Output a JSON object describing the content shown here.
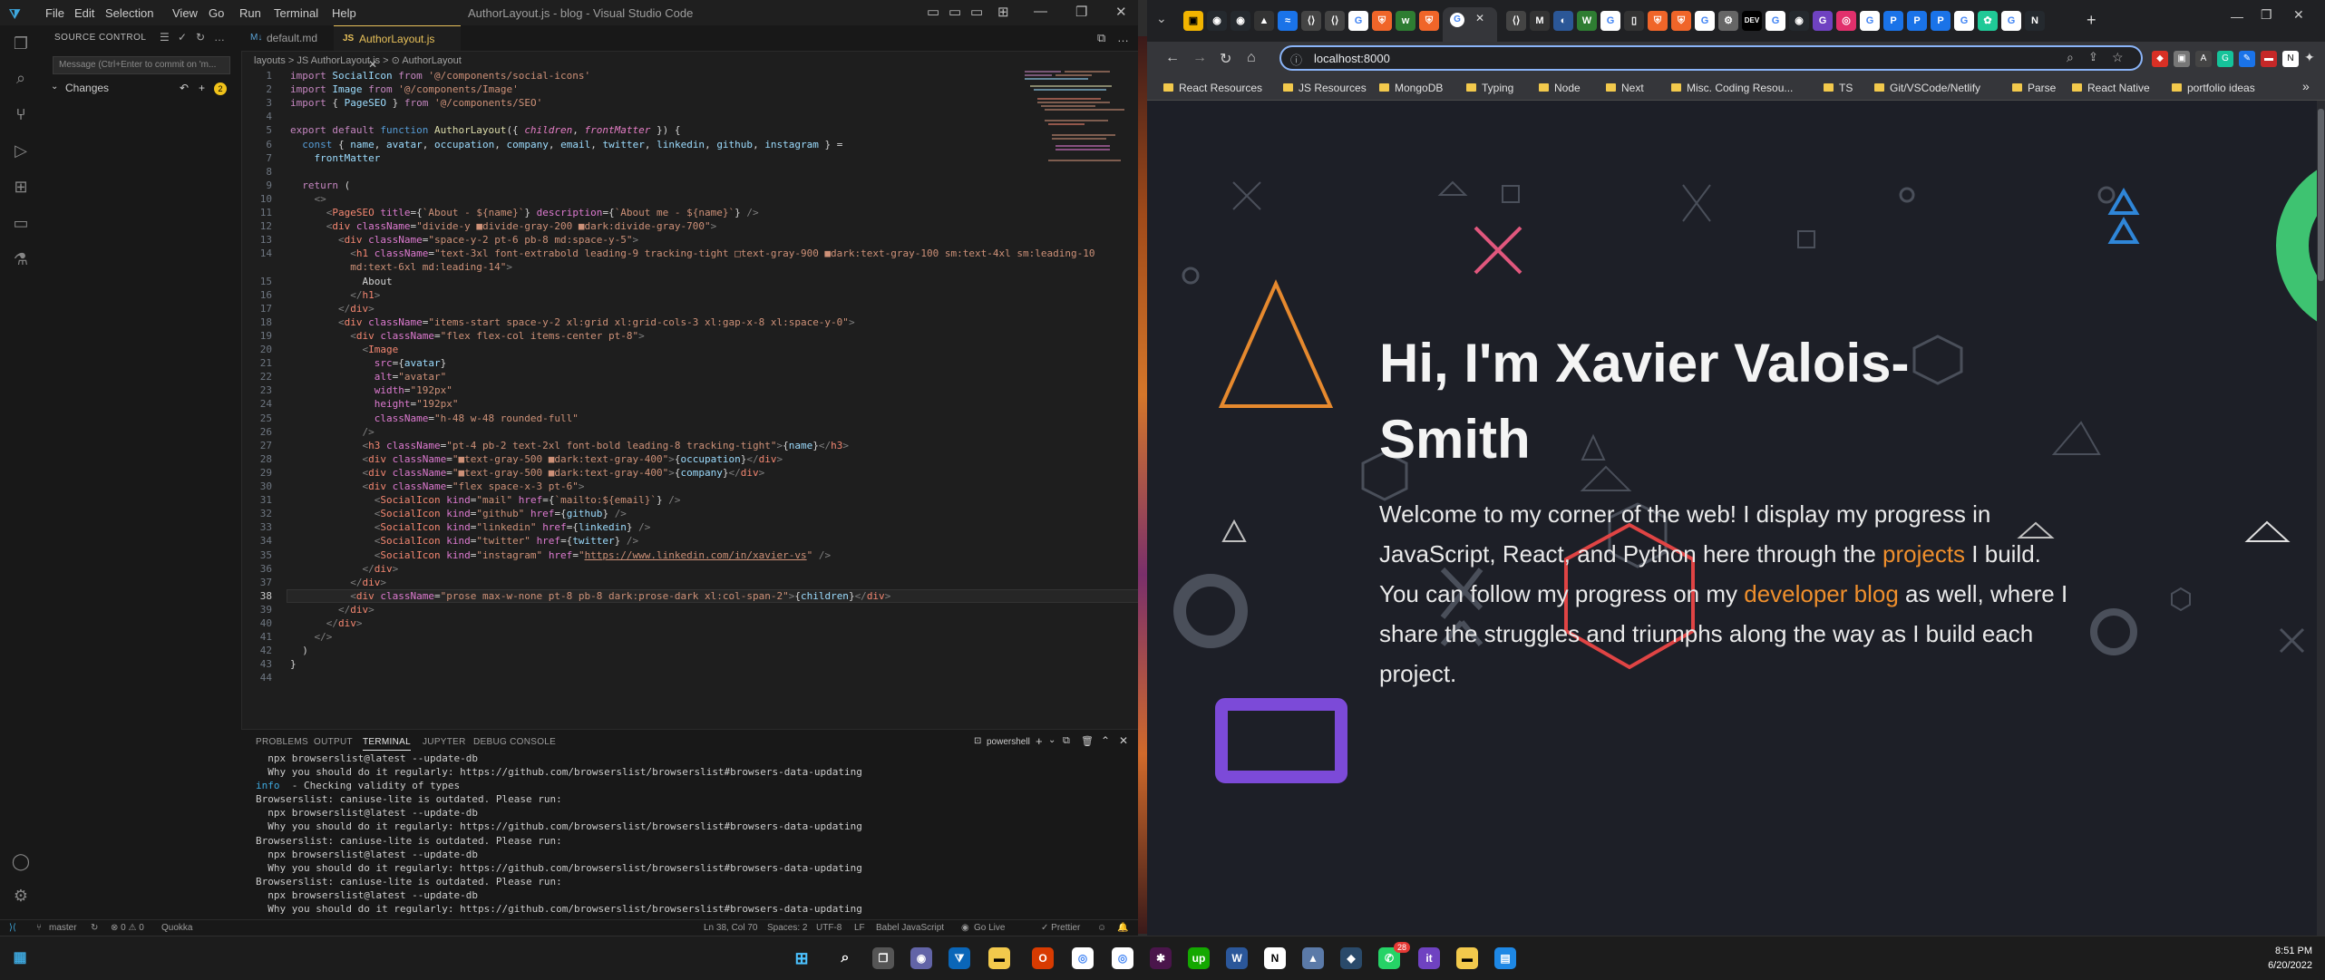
{
  "vscode": {
    "menu": [
      "File",
      "Edit",
      "Selection",
      "View",
      "Go",
      "Run",
      "Terminal",
      "Help"
    ],
    "title": "AuthorLayout.js - blog - Visual Studio Code",
    "sidebar": {
      "header": "SOURCE CONTROL",
      "input_placeholder": "Message (Ctrl+Enter to commit on 'm...",
      "changes_label": "Changes",
      "changes_count": "2"
    },
    "tabs": [
      {
        "label": "default.md",
        "icon": "markdown-icon"
      },
      {
        "label": "AuthorLayout.js",
        "icon": "js-icon"
      }
    ],
    "breadcrumb": "layouts > JS AuthorLayout.js > ⊙ AuthorLayout",
    "panel": {
      "tabs": [
        "PROBLEMS",
        "OUTPUT",
        "TERMINAL",
        "JUPYTER",
        "DEBUG CONSOLE"
      ],
      "active_tab": "TERMINAL",
      "shell": "powershell",
      "terminal_lines": [
        "  npx browserslist@latest --update-db",
        "  Why you should do it regularly: https://github.com/browserslist/browserslist#browsers-data-updating",
        "info  - Checking validity of types",
        "Browserslist: caniuse-lite is outdated. Please run:",
        "  npx browserslist@latest --update-db",
        "  Why you should do it regularly: https://github.com/browserslist/browserslist#browsers-data-updating",
        "Browserslist: caniuse-lite is outdated. Please run:",
        "  npx browserslist@latest --update-db",
        "  Why you should do it regularly: https://github.com/browserslist/browserslist#browsers-data-updating",
        "Browserslist: caniuse-lite is outdated. Please run:",
        "  npx browserslist@latest --update-db",
        "  Why you should do it regularly: https://github.com/browserslist/browserslist#browsers-data-updating"
      ]
    },
    "status": {
      "branch": "master",
      "problems": "⊗ 0 ⚠ 0",
      "quokka": "Quokka",
      "position": "Ln 38, Col 70",
      "spaces": "Spaces: 2",
      "encoding": "UTF-8",
      "eol": "LF",
      "language": "Babel JavaScript",
      "golive": "Go Live",
      "prettier": "✓ Prettier"
    },
    "code_lines": [
      "<span class='kw'>import</span> <span class='vr'>SocialIcon</span> <span class='kw'>from</span> <span class='st'>'@/components/social-icons'</span>",
      "<span class='kw'>import</span> <span class='vr'>Image</span> <span class='kw'>from</span> <span class='st'>'@/components/Image'</span>",
      "<span class='kw'>import</span> { <span class='vr'>PageSEO</span> } <span class='kw'>from</span> <span class='st'>'@/components/SEO'</span>",
      "",
      "<span class='kw'>export default</span> <span class='bl'>function</span> <span class='fn'>AuthorLayout</span>({ <span class='pr'>children</span>, <span class='pr'>frontMatter</span> }) {",
      "  <span class='bl'>const</span> { <span class='vr'>name</span>, <span class='vr'>avatar</span>, <span class='vr'>occupation</span>, <span class='vr'>company</span>, <span class='vr'>email</span>, <span class='vr'>twitter</span>, <span class='vr'>linkedin</span>, <span class='vr'>github</span>, <span class='vr'>instagram</span> } =",
      "    <span class='vr'>frontMatter</span>",
      "",
      "  <span class='kw'>return</span> (",
      "    <span class='gr'>&lt;&gt;</span>",
      "      <span class='gr'>&lt;</span><span class='tg'>PageSEO</span> <span class='at'>title</span>={<span class='st'>`About - ${name}`</span>} <span class='at'>description</span>={<span class='st'>`About me - ${name}`</span>} <span class='gr'>/&gt;</span>",
      "      <span class='gr'>&lt;</span><span class='tg'>div</span> <span class='at'>className</span>=<span class='st'>\"divide-y ■divide-gray-200 ■dark:divide-gray-700\"</span><span class='gr'>&gt;</span>",
      "        <span class='gr'>&lt;</span><span class='tg'>div</span> <span class='at'>className</span>=<span class='st'>\"space-y-2 pt-6 pb-8 md:space-y-5\"</span><span class='gr'>&gt;</span>",
      "          <span class='gr'>&lt;</span><span class='tg'>h1</span> <span class='at'>className</span>=<span class='st'>\"text-3xl font-extrabold leading-9 tracking-tight □text-gray-900 ■dark:text-gray-100 sm:text-4xl sm:leading-10</span>",
      "<span class='st'>          md:text-6xl md:leading-14\"</span><span class='gr'>&gt;</span>",
      "            About",
      "          <span class='gr'>&lt;/</span><span class='tg'>h1</span><span class='gr'>&gt;</span>",
      "        <span class='gr'>&lt;/</span><span class='tg'>div</span><span class='gr'>&gt;</span>",
      "        <span class='gr'>&lt;</span><span class='tg'>div</span> <span class='at'>className</span>=<span class='st'>\"items-start space-y-2 xl:grid xl:grid-cols-3 xl:gap-x-8 xl:space-y-0\"</span><span class='gr'>&gt;</span>",
      "          <span class='gr'>&lt;</span><span class='tg'>div</span> <span class='at'>className</span>=<span class='st'>\"flex flex-col items-center pt-8\"</span><span class='gr'>&gt;</span>",
      "            <span class='gr'>&lt;</span><span class='tg'>Image</span>",
      "              <span class='at'>src</span>={<span class='vr'>avatar</span>}",
      "              <span class='at'>alt</span>=<span class='st'>\"avatar\"</span>",
      "              <span class='at'>width</span>=<span class='st'>\"192px\"</span>",
      "              <span class='at'>height</span>=<span class='st'>\"192px\"</span>",
      "              <span class='at'>className</span>=<span class='st'>\"h-48 w-48 rounded-full\"</span>",
      "            <span class='gr'>/&gt;</span>",
      "            <span class='gr'>&lt;</span><span class='tg'>h3</span> <span class='at'>className</span>=<span class='st'>\"pt-4 pb-2 text-2xl font-bold leading-8 tracking-tight\"</span><span class='gr'>&gt;</span>{<span class='vr'>name</span>}<span class='gr'>&lt;/</span><span class='tg'>h3</span><span class='gr'>&gt;</span>",
      "            <span class='gr'>&lt;</span><span class='tg'>div</span> <span class='at'>className</span>=<span class='st'>\"■text-gray-500 ■dark:text-gray-400\"</span><span class='gr'>&gt;</span>{<span class='vr'>occupation</span>}<span class='gr'>&lt;/</span><span class='tg'>div</span><span class='gr'>&gt;</span>",
      "            <span class='gr'>&lt;</span><span class='tg'>div</span> <span class='at'>className</span>=<span class='st'>\"■text-gray-500 ■dark:text-gray-400\"</span><span class='gr'>&gt;</span>{<span class='vr'>company</span>}<span class='gr'>&lt;/</span><span class='tg'>div</span><span class='gr'>&gt;</span>",
      "            <span class='gr'>&lt;</span><span class='tg'>div</span> <span class='at'>className</span>=<span class='st'>\"flex space-x-3 pt-6\"</span><span class='gr'>&gt;</span>",
      "              <span class='gr'>&lt;</span><span class='tg'>SocialIcon</span> <span class='at'>kind</span>=<span class='st'>\"mail\"</span> <span class='at'>href</span>={<span class='st'>`mailto:${email}`</span>} <span class='gr'>/&gt;</span>",
      "              <span class='gr'>&lt;</span><span class='tg'>SocialIcon</span> <span class='at'>kind</span>=<span class='st'>\"github\"</span> <span class='at'>href</span>={<span class='vr'>github</span>} <span class='gr'>/&gt;</span>",
      "              <span class='gr'>&lt;</span><span class='tg'>SocialIcon</span> <span class='at'>kind</span>=<span class='st'>\"linkedin\"</span> <span class='at'>href</span>={<span class='vr'>linkedin</span>} <span class='gr'>/&gt;</span>",
      "              <span class='gr'>&lt;</span><span class='tg'>SocialIcon</span> <span class='at'>kind</span>=<span class='st'>\"twitter\"</span> <span class='at'>href</span>={<span class='vr'>twitter</span>} <span class='gr'>/&gt;</span>",
      "              <span class='gr'>&lt;</span><span class='tg'>SocialIcon</span> <span class='at'>kind</span>=<span class='st'>\"instagram\"</span> <span class='at'>href</span>=<span class='st'>\"<u>https://www.linkedin.com/in/xavier-vs</u>\"</span> <span class='gr'>/&gt;</span>",
      "            <span class='gr'>&lt;/</span><span class='tg'>div</span><span class='gr'>&gt;</span>",
      "          <span class='gr'>&lt;/</span><span class='tg'>div</span><span class='gr'>&gt;</span>",
      "          <span class='gr'>&lt;</span><span class='tg'>div</span> <span class='at'>className</span>=<span class='st'>\"prose max-w-none pt-8 pb-8 dark:prose-dark xl:col-span-2\"</span><span class='gr'>&gt;</span>{<span class='vr'>children</span>}<span class='gr'>&lt;/</span><span class='tg'>div</span><span class='gr'>&gt;</span>",
      "        <span class='gr'>&lt;/</span><span class='tg'>div</span><span class='gr'>&gt;</span>",
      "      <span class='gr'>&lt;/</span><span class='tg'>div</span><span class='gr'>&gt;</span>",
      "    <span class='gr'>&lt;/&gt;</span>",
      "  )",
      "}",
      ""
    ],
    "line_numbers": [
      "1",
      "2",
      "3",
      "4",
      "5",
      "6",
      "7",
      "8",
      "9",
      "10",
      "11",
      "12",
      "13",
      "14",
      "",
      "15",
      "16",
      "17",
      "18",
      "19",
      "20",
      "21",
      "22",
      "23",
      "24",
      "25",
      "26",
      "27",
      "28",
      "29",
      "30",
      "31",
      "32",
      "33",
      "34",
      "35",
      "36",
      "37",
      "38",
      "39",
      "40",
      "41",
      "42",
      "43",
      "44"
    ]
  },
  "chrome": {
    "url": "localhost:8000",
    "bookmarks": [
      "React Resources",
      "JS Resources",
      "MongoDB",
      "Typing",
      "Node",
      "Next",
      "Misc. Coding Resou...",
      "TS",
      "Git/VSCode/Netlify",
      "Parse",
      "React Native",
      "portfolio ideas"
    ],
    "hero": {
      "title": "Hi, I'm Xavier Valois-Smith",
      "text_1": "Welcome to my corner of the web! I display my progress in JavaScript, React, and Python here through the ",
      "link_1": "projects",
      "text_2": " I build. You can follow my progress on my ",
      "link_2": "developer blog",
      "text_3": " as well, where I share the struggles and triumphs along the way as I build each project."
    },
    "colors": {
      "accent": "#ef8f2c",
      "page_bg": "#1d1f27"
    }
  },
  "taskbar": {
    "time": "8:51 PM",
    "date": "6/20/2022",
    "badge": "28"
  }
}
